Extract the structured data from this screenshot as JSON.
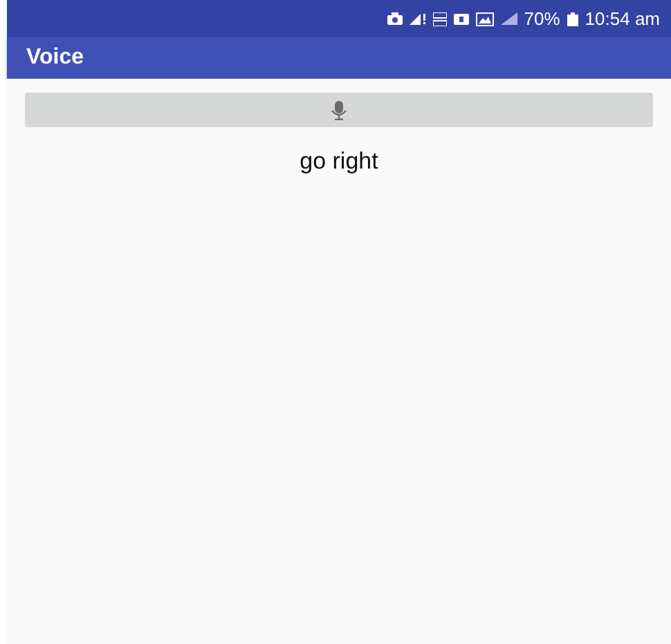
{
  "status_bar": {
    "battery": "70%",
    "time": "10:54 am"
  },
  "app_bar": {
    "title": "Voice"
  },
  "speech_result": "go right"
}
